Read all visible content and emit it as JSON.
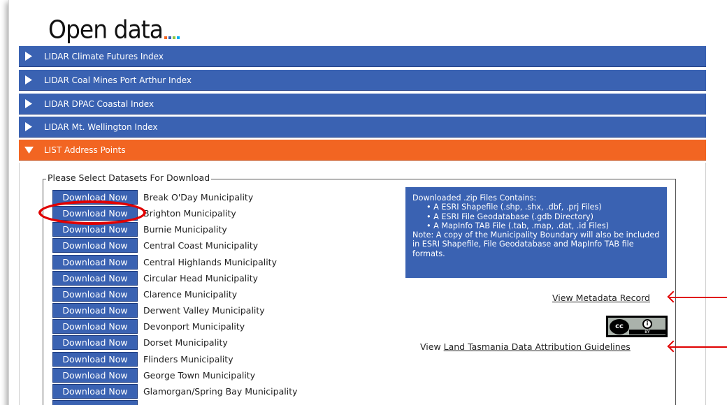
{
  "logo": {
    "text": "Open data",
    "dot_colors": [
      "#f26522",
      "#3a62b2",
      "#8dc63f",
      "#00aeef"
    ]
  },
  "accordion": [
    {
      "label": "LIDAR Climate Futures Index",
      "state": "collapsed"
    },
    {
      "label": "LIDAR Coal Mines Port Arthur Index",
      "state": "collapsed"
    },
    {
      "label": "LIDAR DPAC Coastal Index",
      "state": "collapsed"
    },
    {
      "label": "LIDAR Mt. Wellington Index",
      "state": "collapsed"
    },
    {
      "label": "LIST Address Points",
      "state": "expanded"
    }
  ],
  "colors": {
    "accent_blue": "#3a62b2",
    "accent_orange": "#f26522",
    "highlight_red": "#e00000"
  },
  "panel": {
    "legend": "Please Select Datasets For Download",
    "button_label": "Download Now",
    "datasets": [
      "Break O'Day Municipality",
      "Brighton Municipality",
      "Burnie Municipality",
      "Central Coast Municipality",
      "Central Highlands Municipality",
      "Circular Head Municipality",
      "Clarence Municipality",
      "Derwent Valley Municipality",
      "Devonport Municipality",
      "Dorset Municipality",
      "Flinders Municipality",
      "George Town Municipality",
      "Glamorgan/Spring Bay Municipality"
    ],
    "info": {
      "heading": "Downloaded .zip Files Contains:",
      "bullets": [
        "A ESRI Shapefile (.shp, .shx, .dbf, .prj Files)",
        "A ESRI File Geodatabase (.gdb Directory)",
        "A MapInfo TAB File (.tab, .map, .dat, .id Files)"
      ],
      "note": "Note: A copy of the Municipality Boundary will also be included in ESRI Shapefile, File Geodatabase and MapInfo TAB file formats."
    },
    "metadata_link": "View Metadata Record",
    "license_badge": {
      "icon": "creative-commons-by",
      "text": "BY"
    },
    "attribution": {
      "prefix": "View ",
      "link": "Land Tasmania Data Attribution Guidelines"
    }
  }
}
